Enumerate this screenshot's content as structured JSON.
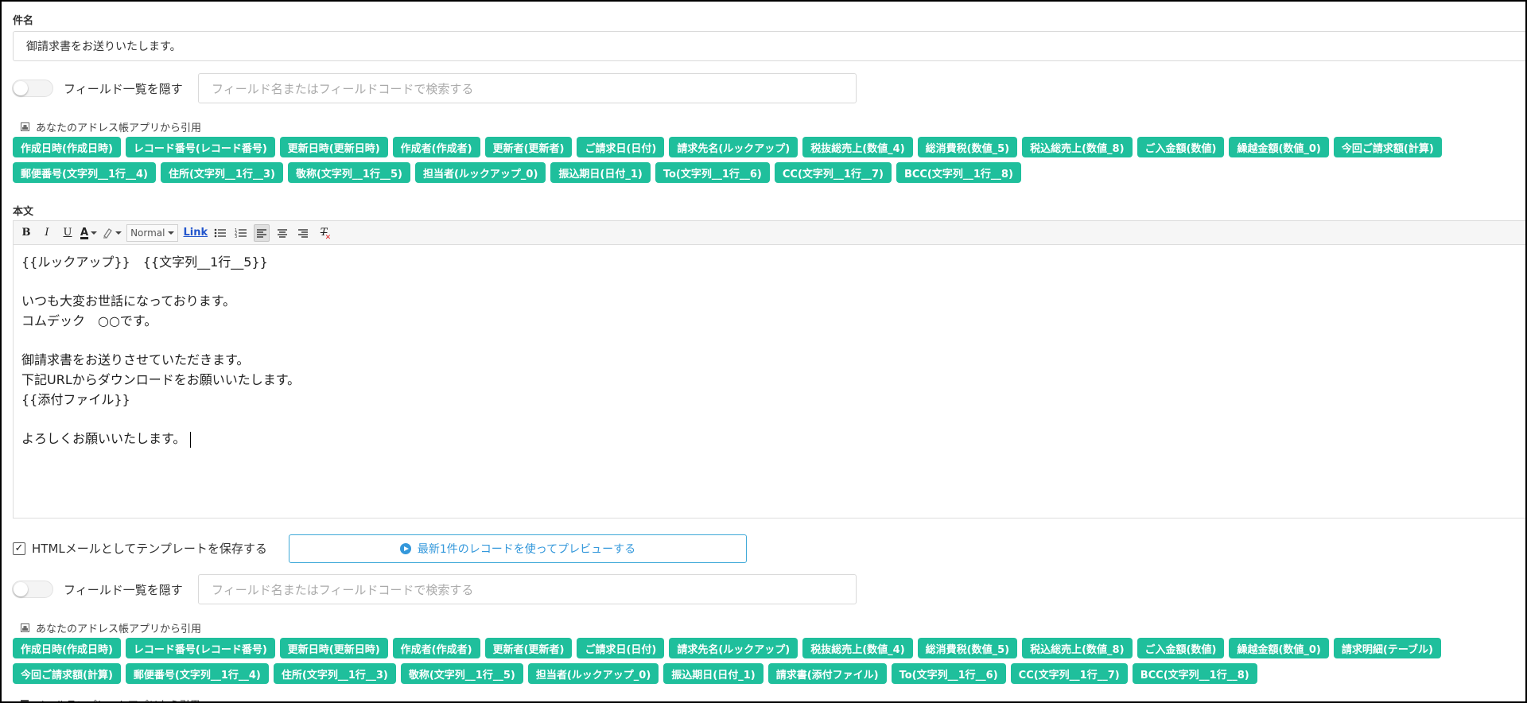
{
  "subject": {
    "label": "件名",
    "value": "御請求書をお送りいたします。"
  },
  "field_filter_top": {
    "toggle_label": "フィールド一覧を隠す",
    "search_placeholder": "フィールド名またはフィールドコードで検索する"
  },
  "address_app_top": {
    "label": "あなたのアドレス帳アプリから引用",
    "chips": [
      "作成日時(作成日時)",
      "レコード番号(レコード番号)",
      "更新日時(更新日時)",
      "作成者(作成者)",
      "更新者(更新者)",
      "ご請求日(日付)",
      "請求先名(ルックアップ)",
      "税抜総売上(数値_4)",
      "総消費税(数値_5)",
      "税込総売上(数値_8)",
      "ご入金額(数値)",
      "繰越金額(数値_0)",
      "今回ご請求額(計算)",
      "郵便番号(文字列__1行__4)",
      "住所(文字列__1行__3)",
      "敬称(文字列__1行__5)",
      "担当者(ルックアップ_0)",
      "振込期日(日付_1)",
      "To(文字列__1行__6)",
      "CC(文字列__1行__7)",
      "BCC(文字列__1行__8)"
    ]
  },
  "body": {
    "label": "本文",
    "toolbar": {
      "bold": "B",
      "italic": "I",
      "underline": "U",
      "font_color": "A",
      "format_value": "Normal",
      "link": "Link",
      "clear": "T"
    },
    "lines": [
      "{{ルックアップ}}　{{文字列__1行__5}}",
      "",
      "いつも大変お世話になっております。",
      "コムデック　○○です。",
      "",
      "御請求書をお送りさせていただきます。",
      "下記URLからダウンロードをお願いいたします。",
      "{{添付ファイル}}",
      "",
      "よろしくお願いいたします。"
    ]
  },
  "html_mail": {
    "checked": true,
    "label": "HTMLメールとしてテンプレートを保存する",
    "preview_button": "最新1件のレコードを使ってプレビューする"
  },
  "field_filter_bottom": {
    "toggle_label": "フィールド一覧を隠す",
    "search_placeholder": "フィールド名またはフィールドコードで検索する"
  },
  "address_app_bottom": {
    "label": "あなたのアドレス帳アプリから引用",
    "chips": [
      "作成日時(作成日時)",
      "レコード番号(レコード番号)",
      "更新日時(更新日時)",
      "作成者(作成者)",
      "更新者(更新者)",
      "ご請求日(日付)",
      "請求先名(ルックアップ)",
      "税抜総売上(数値_4)",
      "総消費税(数値_5)",
      "税込総売上(数値_8)",
      "ご入金額(数値)",
      "繰越金額(数値_0)",
      "請求明細(テーブル)",
      "今回ご請求額(計算)",
      "郵便番号(文字列__1行__4)",
      "住所(文字列__1行__3)",
      "敬称(文字列__1行__5)",
      "担当者(ルックアップ_0)",
      "振込期日(日付_1)",
      "請求書(添付ファイル)",
      "To(文字列__1行__6)",
      "CC(文字列__1行__7)",
      "BCC(文字列__1行__8)"
    ]
  },
  "template_app": {
    "label": "メールテンプレートアプリから引用"
  },
  "colors": {
    "chip": "#1fbf9c",
    "preview_accent": "#3498db"
  }
}
